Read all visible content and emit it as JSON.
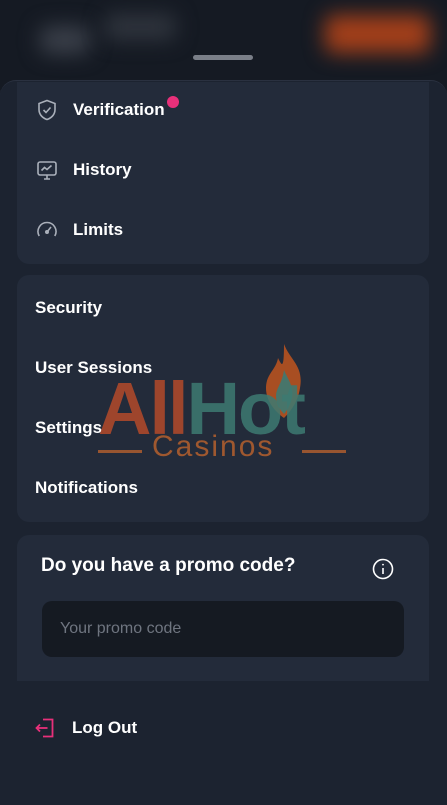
{
  "menu_group_1": [
    {
      "label": "Verification",
      "icon": "shield-check-icon",
      "has_notification": true
    },
    {
      "label": "History",
      "icon": "monitor-chart-icon",
      "has_notification": false
    },
    {
      "label": "Limits",
      "icon": "gauge-icon",
      "has_notification": false
    }
  ],
  "menu_group_2": [
    {
      "label": "Security"
    },
    {
      "label": "User Sessions"
    },
    {
      "label": "Settings"
    },
    {
      "label": "Notifications"
    }
  ],
  "promo": {
    "title": "Do you have a promo code?",
    "placeholder": "Your promo code",
    "value": ""
  },
  "logout": {
    "label": "Log Out",
    "icon": "logout-icon"
  },
  "watermark": {
    "brand": "AllHot",
    "sub": "Casinos"
  },
  "colors": {
    "background": "#1a202b",
    "card": "#232b3a",
    "accent_pink": "#e8307a",
    "input_bg": "#151a22"
  }
}
